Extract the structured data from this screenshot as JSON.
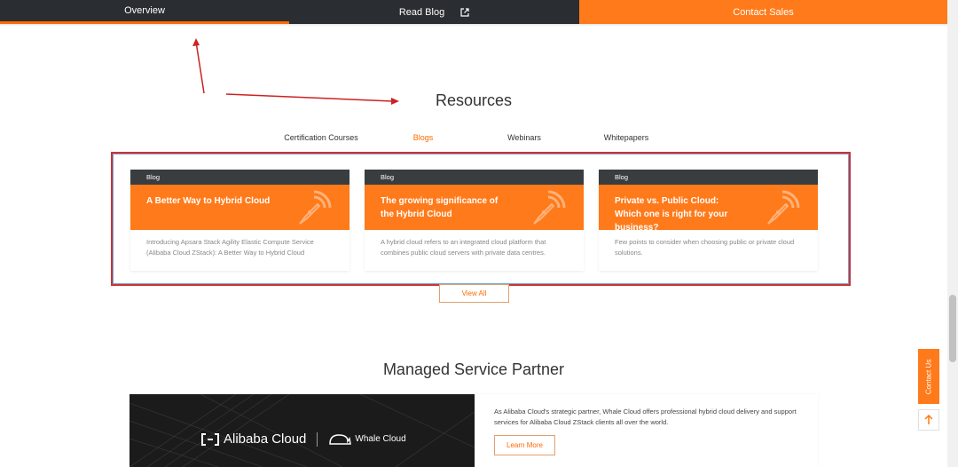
{
  "topnav": {
    "overview": "Overview",
    "read_blog": "Read Blog",
    "contact_sales": "Contact Sales"
  },
  "resources": {
    "title": "Resources",
    "tabs": [
      "Certification Courses",
      "Blogs",
      "Webinars",
      "Whitepapers"
    ],
    "active_tab": "Blogs",
    "cards": [
      {
        "category": "Blog",
        "title": "A Better Way to Hybrid Cloud",
        "description": "Introducing Apsara Stack Agility Elastic Compute Service (Alibaba Cloud ZStack): A Better Way to Hybrid Cloud"
      },
      {
        "category": "Blog",
        "title": "The growing significance of the Hybrid Cloud",
        "description": "A hybrid cloud refers to an integrated cloud platform that combines public cloud servers with private data centres."
      },
      {
        "category": "Blog",
        "title": "Private vs. Public Cloud: Which one is right for your business?",
        "description": "Few points to consider when choosing public or private cloud solutions."
      }
    ],
    "view_all": "View All"
  },
  "msp": {
    "title": "Managed Service Partner",
    "logo_alibaba": "Alibaba Cloud",
    "logo_whale": "Whale Cloud",
    "description": "As Alibaba Cloud's strategic partner, Whale Cloud offers professional hybrid cloud delivery and support services for Alibaba Cloud ZStack clients all over the world.",
    "learn_more": "Learn More"
  },
  "side": {
    "contact_us": "Contact Us"
  },
  "colors": {
    "accent": "#ff7a1a",
    "dark": "#2a2d31",
    "annotation": "#cc2222"
  }
}
